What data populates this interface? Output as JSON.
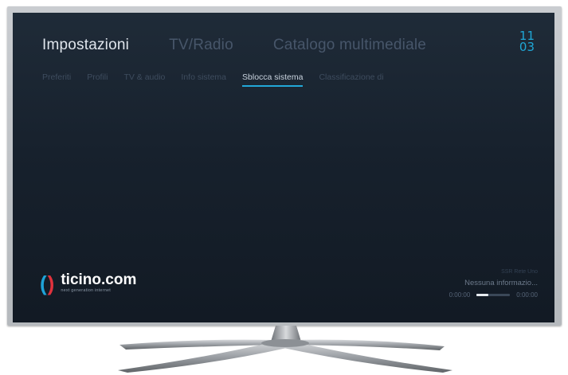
{
  "main_nav": [
    {
      "label": "Impostazioni",
      "active": true
    },
    {
      "label": "TV/Radio",
      "active": false
    },
    {
      "label": "Catalogo multimediale",
      "active": false
    }
  ],
  "clock": {
    "hours": "11",
    "minutes": "03"
  },
  "sub_nav": [
    {
      "label": "Preferiti",
      "active": false
    },
    {
      "label": "Profili",
      "active": false
    },
    {
      "label": "TV & audio",
      "active": false
    },
    {
      "label": "Info sistema",
      "active": false
    },
    {
      "label": "Sblocca sistema",
      "active": true
    },
    {
      "label": "Classificazione di",
      "active": false
    }
  ],
  "logo": {
    "left_bracket": "(",
    "right_bracket": ")",
    "name": "ticino.com",
    "tagline": "next generation internet"
  },
  "now_playing": {
    "channel": "SSR Rete Uno",
    "info": "Nessuna informazio...",
    "time_start": "0:00:00",
    "time_end": "0:00:00",
    "progress": 0.35
  },
  "colors": {
    "accent": "#22a8d8",
    "brand_red": "#e0323d",
    "screen_bg": "#17212d"
  }
}
